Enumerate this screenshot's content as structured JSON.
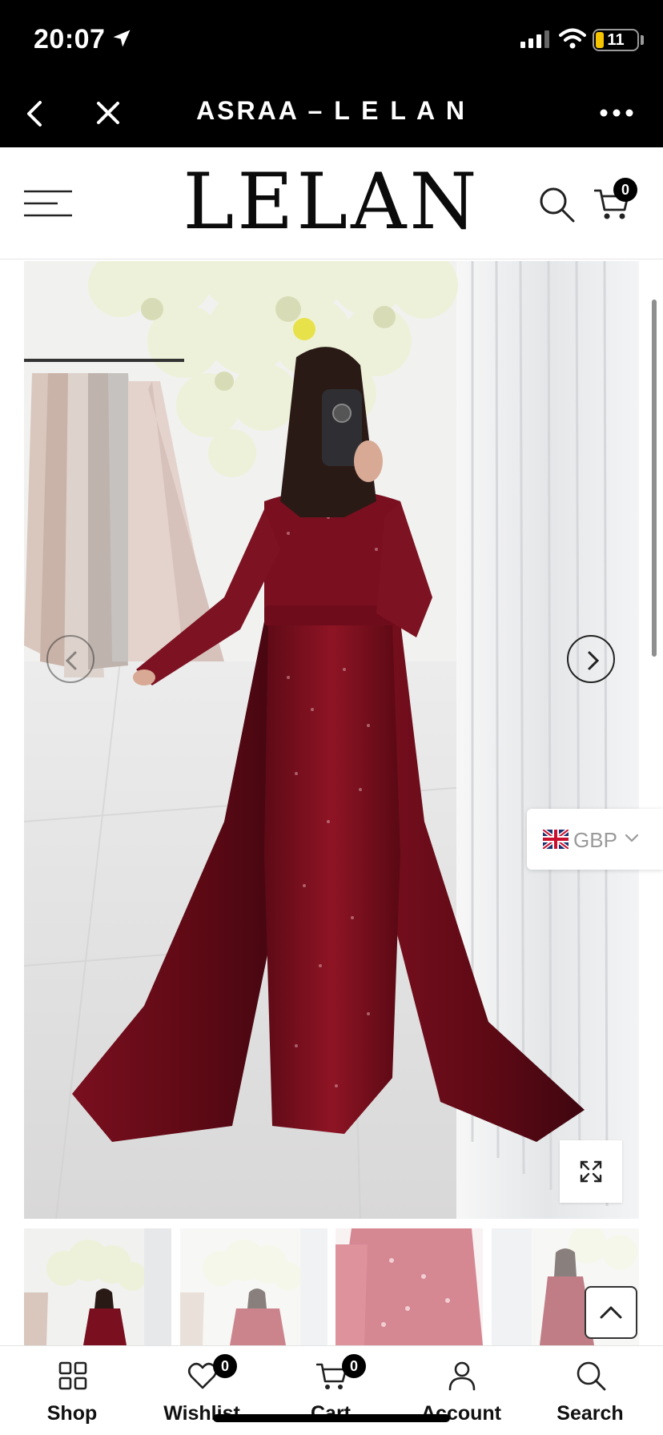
{
  "status_bar": {
    "time": "20:07",
    "battery": "11",
    "icons": [
      "location-arrow-icon",
      "signal-icon",
      "wifi-icon",
      "battery-icon"
    ]
  },
  "browser": {
    "title": "ASRAA – L E L A N",
    "icons": [
      "back-icon",
      "close-icon",
      "more-icon"
    ]
  },
  "store": {
    "logo": "LELAN",
    "cart_count": "0",
    "icons": [
      "menu-icon",
      "search-icon",
      "cart-icon"
    ]
  },
  "product": {
    "image_icons": [
      "prev-arrow-icon",
      "next-arrow-icon",
      "expand-icon"
    ]
  },
  "currency": {
    "code": "GBP",
    "flag": "uk-flag-icon"
  },
  "thumbnails": {
    "count": 4,
    "selected_index": 0
  },
  "bottom_nav": {
    "items": [
      {
        "label": "Shop",
        "icon": "grid-icon"
      },
      {
        "label": "Wishlist",
        "icon": "heart-icon",
        "badge": "0"
      },
      {
        "label": "Cart",
        "icon": "cart-icon",
        "badge": "0"
      },
      {
        "label": "Account",
        "icon": "user-icon"
      },
      {
        "label": "Search",
        "icon": "search-icon"
      }
    ]
  },
  "colors": {
    "header_bg": "#000000",
    "dress": "#7a0d1e",
    "accent": "#111111"
  }
}
